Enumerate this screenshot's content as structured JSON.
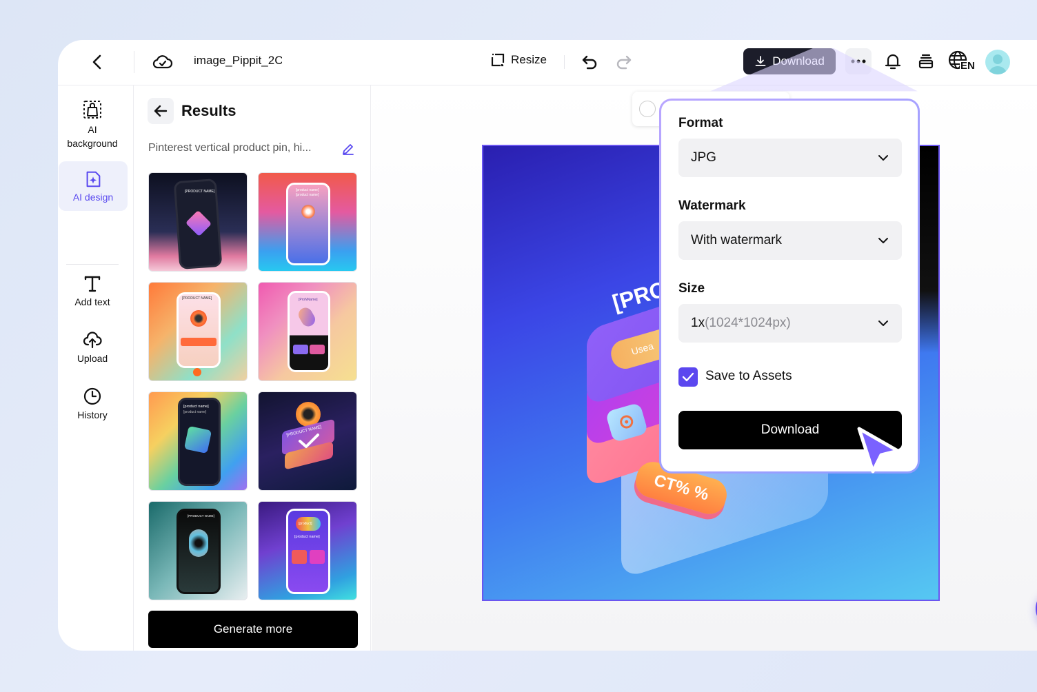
{
  "topbar": {
    "title": "image_Pippit_2C",
    "resize_label": "Resize",
    "download_label": "Download",
    "lang_label": "EN"
  },
  "rail": {
    "items": [
      {
        "label": "AI background"
      },
      {
        "label": "AI design"
      },
      {
        "label": "Add text"
      },
      {
        "label": "Upload"
      },
      {
        "label": "History"
      }
    ]
  },
  "results": {
    "title": "Results",
    "prompt": "Pinterest vertical product pin, hi...",
    "generate_more_label": "Generate more"
  },
  "thumbnails": {
    "t1": {
      "line1": "[PRODUCT NAME]"
    },
    "t2": {
      "line1": "[product name]",
      "line2": "[product name]"
    },
    "t3": {
      "line1": "[PRODUCT NAME]"
    },
    "t4": {
      "line1": "[ProNName]"
    },
    "t5": {
      "line1": "[product name]",
      "line2": "[product name]"
    },
    "t6": {
      "line1": "[PRODUCT NAME]"
    },
    "t7": {
      "line1": "[PRODUCT NAME]"
    },
    "t8": {
      "line1": "[product]",
      "line2": "[product name]"
    }
  },
  "artwork": {
    "headline": "[PRO",
    "chip_text": "Usea",
    "badge_text": "CT% %"
  },
  "popover": {
    "format_label": "Format",
    "format_value": "JPG",
    "watermark_label": "Watermark",
    "watermark_value": "With watermark",
    "size_label": "Size",
    "size_value_main": "1x",
    "size_value_detail": "(1024*1024px)",
    "save_assets_label": "Save to Assets",
    "save_assets_checked": true,
    "download_label": "Download"
  },
  "colors": {
    "accent": "#5b47ef",
    "dark_button": "#1c1d2a",
    "black_button": "#000000"
  }
}
